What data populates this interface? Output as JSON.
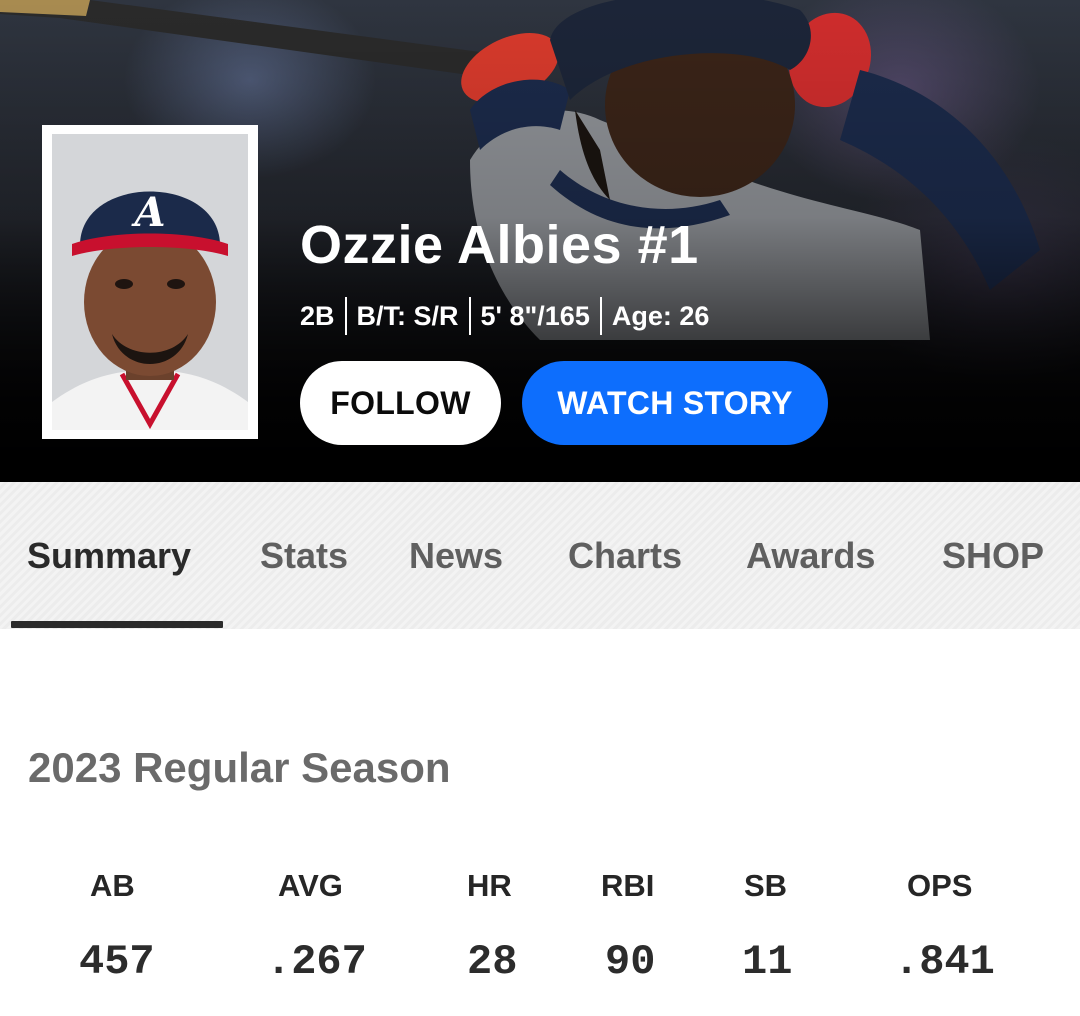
{
  "player": {
    "name": "Ozzie Albies #1",
    "position": "2B",
    "bats_throws": "B/T: S/R",
    "height_weight": "5' 8\"/165",
    "age": "Age: 26"
  },
  "actions": {
    "follow_label": "FOLLOW",
    "watch_story_label": "WATCH STORY"
  },
  "tabs": [
    {
      "label": "Summary",
      "active": true
    },
    {
      "label": "Stats",
      "active": false
    },
    {
      "label": "News",
      "active": false
    },
    {
      "label": "Charts",
      "active": false
    },
    {
      "label": "Awards",
      "active": false
    },
    {
      "label": "SHOP",
      "active": false
    }
  ],
  "season": {
    "title": "2023 Regular Season",
    "stats": [
      {
        "label": "AB",
        "value": "457"
      },
      {
        "label": "AVG",
        "value": ".267"
      },
      {
        "label": "HR",
        "value": "28"
      },
      {
        "label": "RBI",
        "value": "90"
      },
      {
        "label": "SB",
        "value": "11"
      },
      {
        "label": "OPS",
        "value": ".841"
      }
    ]
  },
  "colors": {
    "accent_blue": "#0d6efd",
    "team_navy": "#1b2a4a",
    "team_red": "#c8102e"
  },
  "icons": {
    "team_logo": "braves-a-logo"
  }
}
